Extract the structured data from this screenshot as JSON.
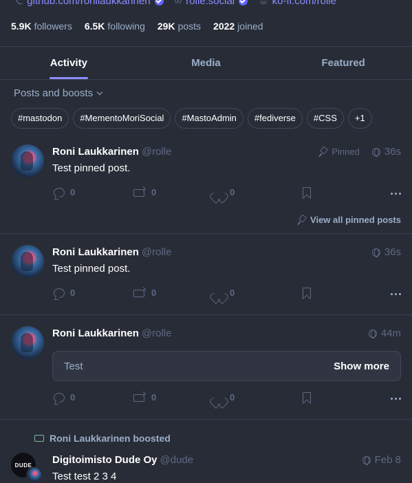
{
  "profile": {
    "links": [
      {
        "label": "github.com/ronilaukkarinen",
        "icon": "github-icon",
        "verified": true
      },
      {
        "label": "rolle.social",
        "icon": "link-icon",
        "verified": true
      },
      {
        "label": "ko-fi.com/rolle",
        "icon": "coffee-icon",
        "verified": false
      }
    ],
    "stats": [
      {
        "value": "5.9K",
        "label": "followers"
      },
      {
        "value": "6.5K",
        "label": "following"
      },
      {
        "value": "29K",
        "label": "posts"
      },
      {
        "value": "2022",
        "label": "joined"
      }
    ]
  },
  "tabs": [
    {
      "label": "Activity",
      "active": true
    },
    {
      "label": "Media",
      "active": false
    },
    {
      "label": "Featured",
      "active": false
    }
  ],
  "filter": {
    "label": "Posts and boosts"
  },
  "hashtags": [
    "#mastodon",
    "#MementoMoriSocial",
    "#MastoAdmin",
    "#fediverse",
    "#CSS",
    "+1"
  ],
  "statuses": [
    {
      "name": "Roni Laukkarinen",
      "handle": "@rolle",
      "pinned_label": "Pinned",
      "time": "36s",
      "content": "Test pinned post.",
      "replies": "0",
      "boosts": "0",
      "favourites": "0",
      "view_pinned": "View all pinned posts"
    },
    {
      "name": "Roni Laukkarinen",
      "handle": "@rolle",
      "time": "36s",
      "content": "Test pinned post.",
      "replies": "0",
      "boosts": "0",
      "favourites": "0"
    },
    {
      "name": "Roni Laukkarinen",
      "handle": "@rolle",
      "time": "44m",
      "cw_text": "Test",
      "cw_button": "Show more",
      "replies": "0",
      "boosts": "0",
      "favourites": "0"
    },
    {
      "boosted_by": "Roni Laukkarinen boosted",
      "name": "Digitoimisto Dude Oy",
      "handle": "@dude",
      "avatar_text": "DUDE",
      "time": "Feb 8",
      "content": "Test test 2 3 4"
    }
  ],
  "colors": {
    "accent": "#8c8dff",
    "background": "#282c37",
    "boost": "#79bd9a"
  }
}
